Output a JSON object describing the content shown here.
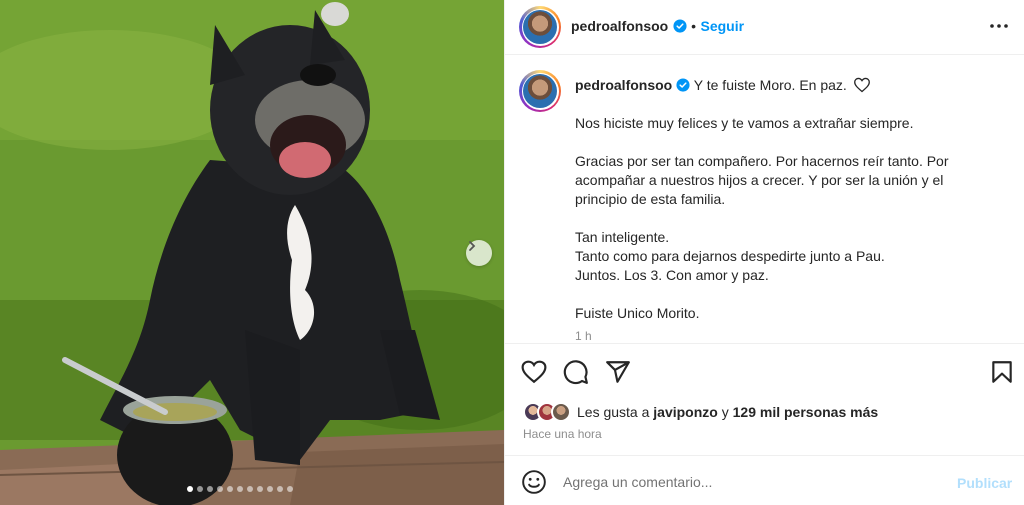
{
  "media": {
    "carousel": {
      "slide_count": 11,
      "active_index": 0
    },
    "next_icon": "chevron-right-icon"
  },
  "header": {
    "username": "pedroalfonsoo",
    "separator": "•",
    "follow_label": "Seguir",
    "more_icon": "more-horizontal-icon"
  },
  "caption": {
    "username": "pedroalfonsoo",
    "title": "Y te fuiste Moro. En paz.",
    "paragraphs": [
      "Nos hiciste muy felices y te vamos a extrañar siempre.",
      "Gracias por ser tan compañero. Por hacernos reír tanto. Por acompañar a nuestros hijos a crecer. Y por ser la unión y el principio de esta familia.",
      "Tan inteligente.\nTanto como para dejarnos despedirte junto a Pau.\nJuntos. Los 3. Con amor y paz.",
      "Fuiste Unico Morito."
    ],
    "time": "1 h"
  },
  "actions": {
    "like_icon": "heart-icon",
    "comment_icon": "comment-icon",
    "share_icon": "share-icon",
    "save_icon": "bookmark-icon"
  },
  "likes": {
    "prefix": "Les gusta a",
    "liker": "javiponzo",
    "connector": "y",
    "count_text": "129 mil personas más"
  },
  "posted": "Hace una hora",
  "comment_box": {
    "placeholder": "Agrega un comentario...",
    "publish_label": "Publicar",
    "emoji_icon": "emoji-icon"
  },
  "colors": {
    "accent": "#0095f6",
    "publish_disabled": "#b2dffc",
    "muted": "#8e8e8e"
  }
}
